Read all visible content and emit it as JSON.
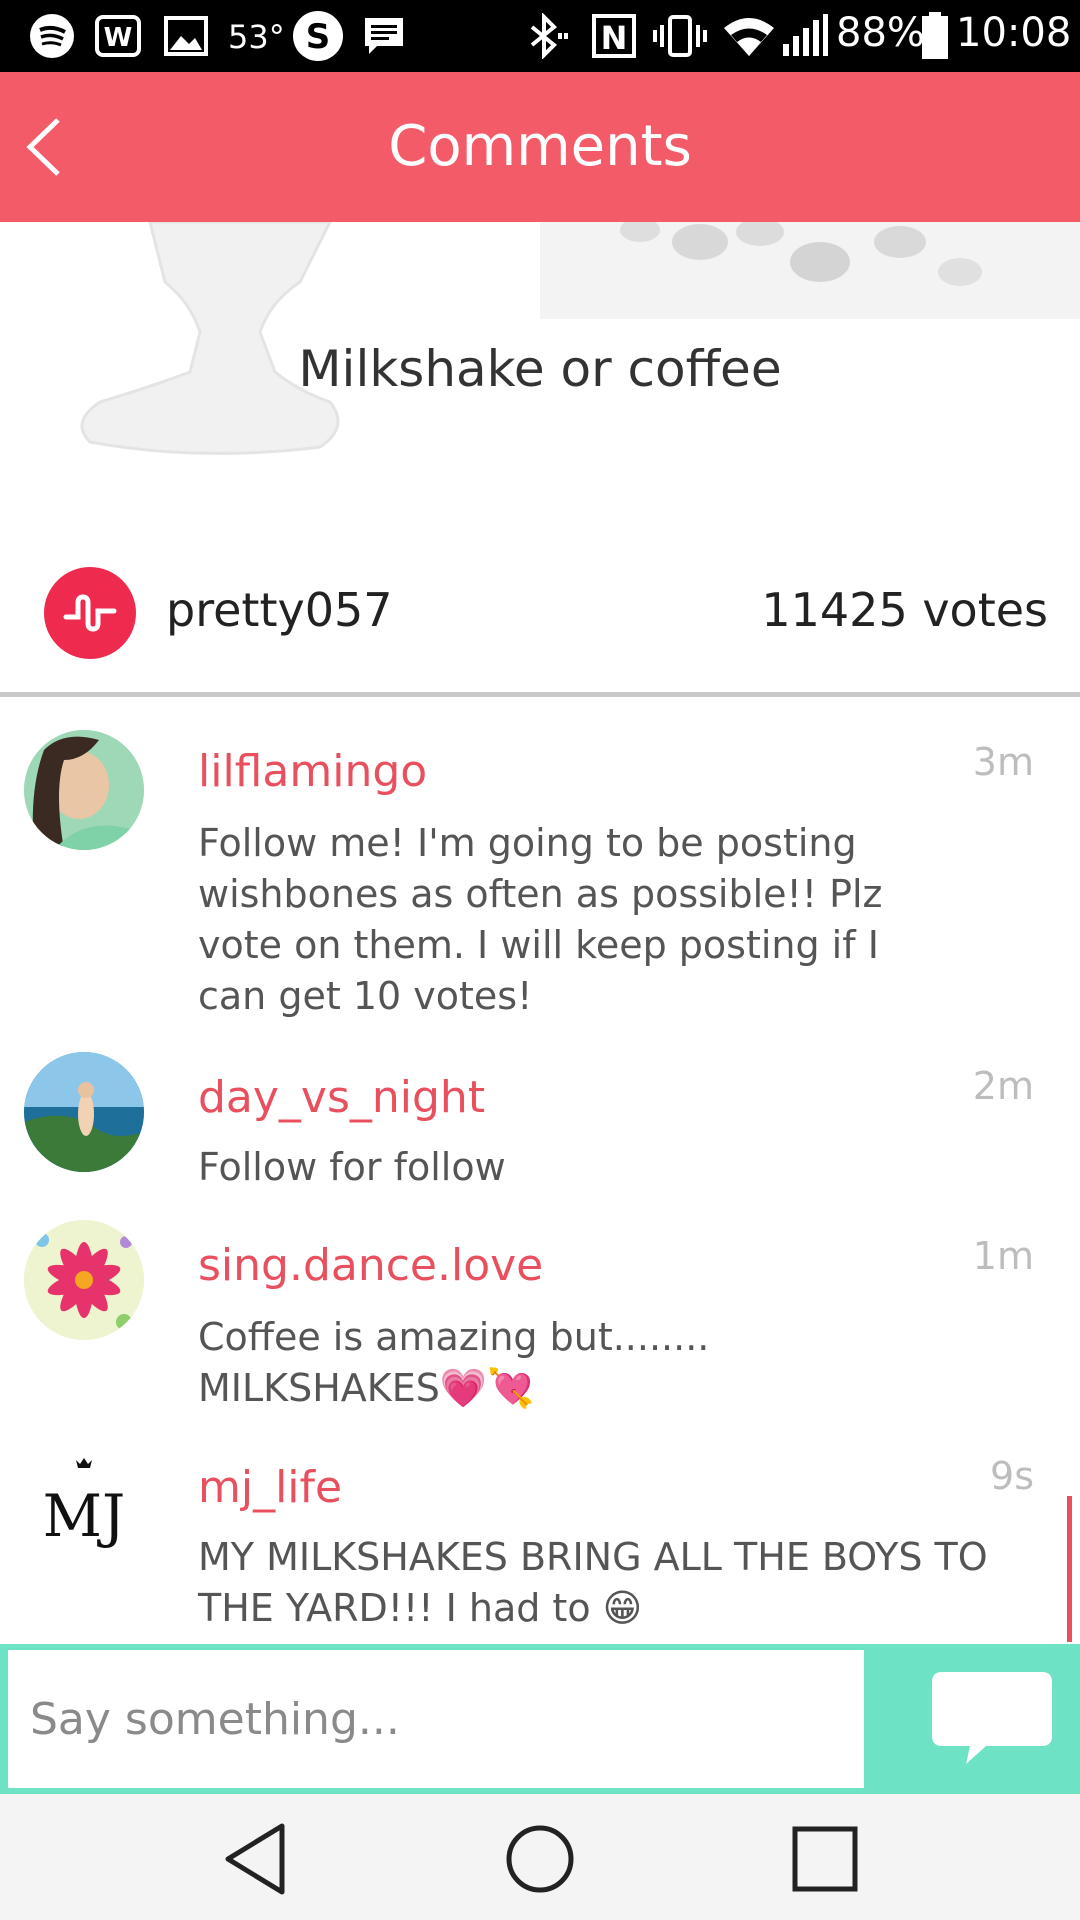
{
  "status_bar": {
    "temperature": "53°",
    "battery": "88%",
    "time": "10:08",
    "icons": [
      "spotify-icon",
      "wunderlist-icon",
      "gallery-icon",
      "skype-icon",
      "message-icon",
      "bluetooth-icon",
      "nfc-icon",
      "vibrate-icon",
      "wifi-icon",
      "signal-icon",
      "battery-icon"
    ]
  },
  "header": {
    "title": "Comments",
    "back_icon": "chevron-left-icon"
  },
  "post": {
    "title": "Milkshake or coffee",
    "author": "pretty057",
    "votes": "11425 votes"
  },
  "comments": [
    {
      "user": "lilflamingo",
      "time": "3m",
      "text": "Follow me! I'm going to be posting wishbones as often as possible!! Plz vote on them. I will keep posting if I can get 10 votes!"
    },
    {
      "user": "day_vs_night",
      "time": "2m",
      "text": "Follow for follow"
    },
    {
      "user": "sing.dance.love",
      "time": "1m",
      "text": "Coffee is amazing but........ MILKSHAKES💗💘"
    },
    {
      "user": "mj_life",
      "time": "9s",
      "text": "MY MILKSHAKES BRING ALL THE BOYS TO THE YARD!!! I had to 😁"
    }
  ],
  "input": {
    "placeholder": "Say something..."
  },
  "colors": {
    "header": "#f45b69",
    "accent": "#e8505e",
    "input_bar": "#6ee2c4",
    "logo": "#ee2a4e"
  }
}
